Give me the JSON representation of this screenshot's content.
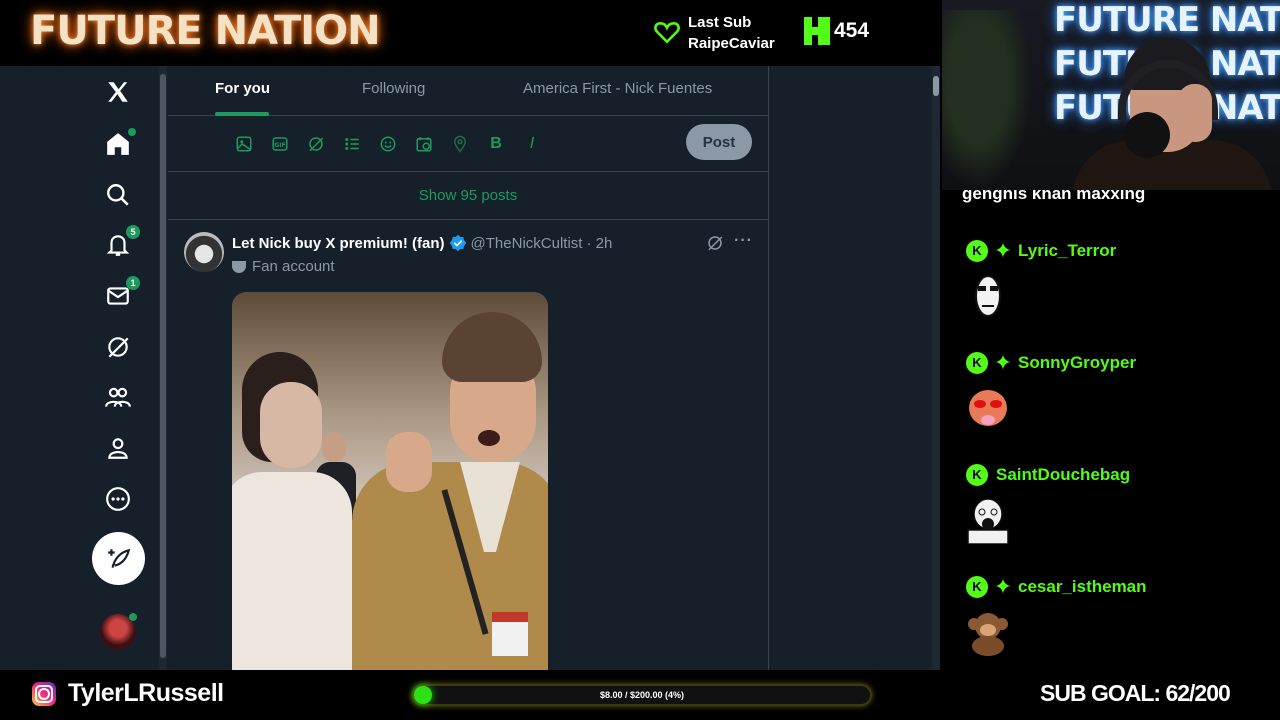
{
  "overlay": {
    "brand": "FUTURE NATION",
    "last_sub": {
      "label": "Last Sub",
      "name": "RaipeCaviar"
    },
    "kick_viewers": "454"
  },
  "twitter": {
    "nav": {
      "icons": [
        "x-logo-icon",
        "home-icon",
        "search-icon",
        "notifications-icon",
        "messages-icon",
        "grok-icon",
        "communities-icon",
        "profile-icon",
        "more-icon"
      ],
      "notifications_badge": "5",
      "messages_badge": "1"
    },
    "tabs": [
      "For you",
      "Following",
      "America First - Nick Fuentes"
    ],
    "active_tab": "For you",
    "composer": {
      "tools": [
        "image-icon",
        "gif-icon",
        "grok-icon",
        "poll-icon",
        "emoji-icon",
        "schedule-icon",
        "location-icon",
        "bold-icon",
        "italic-icon"
      ],
      "bold_glyph": "B",
      "italic_glyph": "I",
      "post_label": "Post"
    },
    "show_posts": "Show 95 posts",
    "tweet": {
      "name": "Let Nick buy X premium! (fan)",
      "handle": "@TheNickCultist",
      "time": "· 2h",
      "label": "Fan account",
      "more": "···"
    },
    "colors": {
      "bg": "#15202b",
      "accent": "#1d9b5c",
      "text_secondary": "#8b98a5"
    }
  },
  "webcam": {
    "neon_lines": [
      "FUTURE NATION",
      "FUTURE NATION",
      "FUTURE NATION"
    ]
  },
  "chat": {
    "partial_message": "gengnis khan maxxing",
    "messages": [
      {
        "user": "Lyric_Terror",
        "has_star": true
      },
      {
        "user": "SonnyGroyper",
        "has_star": true
      },
      {
        "user": "SaintDouchebag",
        "has_star": false
      },
      {
        "user": "cesar_istheman",
        "has_star": true
      }
    ],
    "username_color": "#53fc18"
  },
  "bottom": {
    "instagram_handle": "TylerLRussell",
    "progress_text": "$8.00 / $200.00 (4%)",
    "progress_fraction": 0.04,
    "sub_goal": "SUB GOAL: 62/200"
  }
}
